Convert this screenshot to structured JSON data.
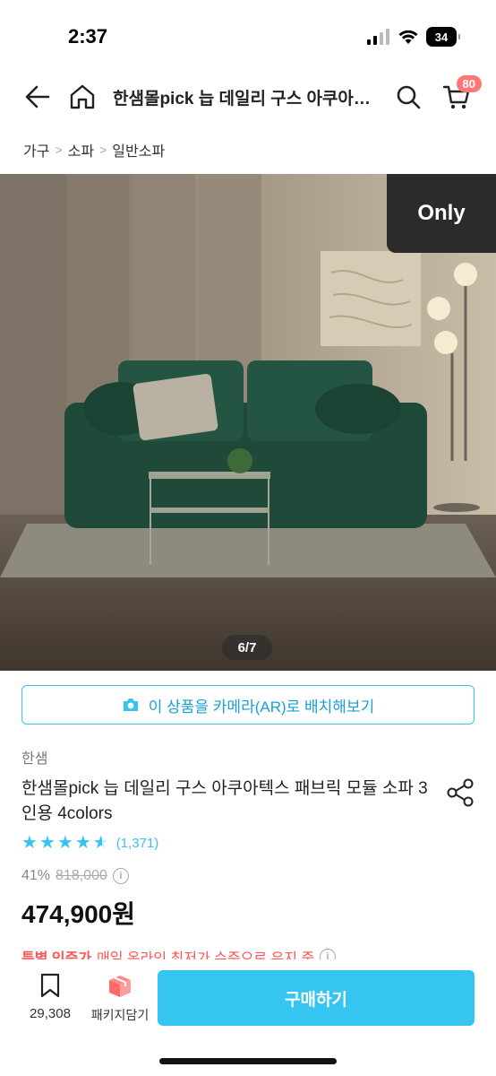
{
  "status": {
    "time": "2:37",
    "battery": "34"
  },
  "nav": {
    "title": "한샘몰pick 늡 데일리 구스 아쿠아텍스 패브릭 모듈 소파 3인용 4colors",
    "cart_count": "80"
  },
  "breadcrumb": [
    "가구",
    "소파",
    "일반소파"
  ],
  "hero": {
    "badge": "Only",
    "page": "6/7"
  },
  "ar_button": "이 상품을 카메라(AR)로 배치해보기",
  "product": {
    "brand": "한샘",
    "title": "한샘몰pick 늡 데일리 구스 아쿠아텍스 패브릭 모듈 소파 3인용 4colors",
    "rating": 4.5,
    "review_count": "(1,371)",
    "discount": "41%",
    "original_price": "818,000",
    "price": "474,900원",
    "special_label": "특별 인증가",
    "special_text": "매일 온라인 최저가 수준으로 유지 중"
  },
  "bottom": {
    "scrap_count": "29,308",
    "package_label": "패키지담기",
    "buy_label": "구매하기"
  },
  "colors": {
    "accent": "#35c5f0",
    "badge": "#ff7777",
    "special": "#ff5555"
  }
}
